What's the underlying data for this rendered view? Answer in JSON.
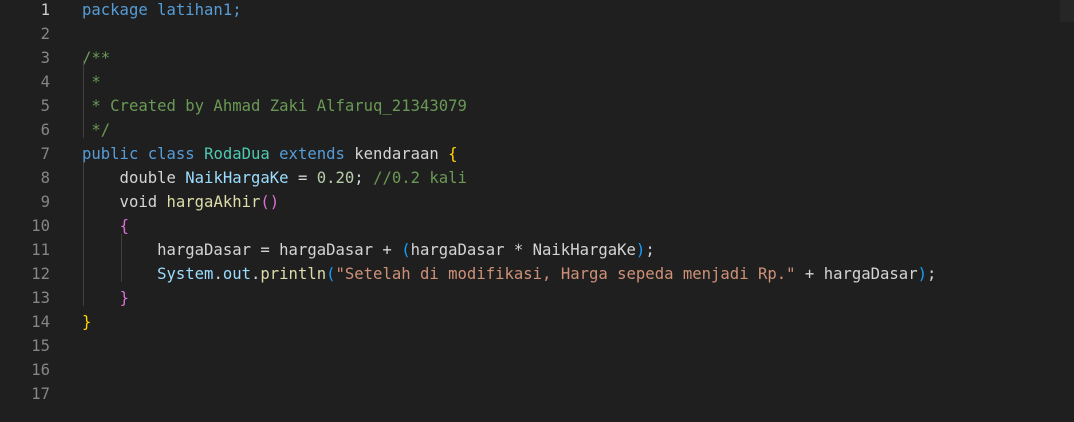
{
  "editor": {
    "language": "java",
    "active_line": 1,
    "line_numbers": [
      "1",
      "2",
      "3",
      "4",
      "5",
      "6",
      "7",
      "8",
      "9",
      "10",
      "11",
      "12",
      "13",
      "14",
      "15",
      "16",
      "17"
    ],
    "lines": [
      [
        {
          "t": "package latihan1;",
          "c": "kw"
        }
      ],
      [],
      [
        {
          "t": "/**",
          "c": "cm"
        }
      ],
      [
        {
          "t": " *",
          "c": "cm"
        }
      ],
      [
        {
          "t": " * Created by Ahmad Zaki Alfaruq_21343079",
          "c": "cm"
        }
      ],
      [
        {
          "t": " */",
          "c": "cm"
        }
      ],
      [
        {
          "t": "public class ",
          "c": "kw"
        },
        {
          "t": "RodaDua",
          "c": "cls"
        },
        {
          "t": " extends ",
          "c": "kw"
        },
        {
          "t": "kendaraan ",
          "c": "plain"
        },
        {
          "t": "{",
          "c": "br1"
        }
      ],
      [
        {
          "t": "    double ",
          "c": "plain"
        },
        {
          "t": "NaikHargaKe",
          "c": "var"
        },
        {
          "t": " = ",
          "c": "plain"
        },
        {
          "t": "0.20",
          "c": "num"
        },
        {
          "t": "; ",
          "c": "plain"
        },
        {
          "t": "//0.2 kali",
          "c": "cm"
        }
      ],
      [
        {
          "t": "    void ",
          "c": "plain"
        },
        {
          "t": "hargaAkhir",
          "c": "fn"
        },
        {
          "t": "()",
          "c": "br2"
        }
      ],
      [
        {
          "t": "    ",
          "c": "plain"
        },
        {
          "t": "{",
          "c": "br2"
        }
      ],
      [
        {
          "t": "        hargaDasar = hargaDasar + ",
          "c": "plain"
        },
        {
          "t": "(",
          "c": "br3"
        },
        {
          "t": "hargaDasar * NaikHargaKe",
          "c": "plain"
        },
        {
          "t": ")",
          "c": "br3"
        },
        {
          "t": ";",
          "c": "plain"
        }
      ],
      [
        {
          "t": "        System",
          "c": "var"
        },
        {
          "t": ".",
          "c": "plain"
        },
        {
          "t": "out",
          "c": "var"
        },
        {
          "t": ".",
          "c": "plain"
        },
        {
          "t": "println",
          "c": "fn"
        },
        {
          "t": "(",
          "c": "br3"
        },
        {
          "t": "\"Setelah di modifikasi, Harga sepeda menjadi Rp.\"",
          "c": "str"
        },
        {
          "t": " + hargaDasar",
          "c": "plain"
        },
        {
          "t": ")",
          "c": "br3"
        },
        {
          "t": ";",
          "c": "plain"
        }
      ],
      [
        {
          "t": "    ",
          "c": "plain"
        },
        {
          "t": "}",
          "c": "br2"
        }
      ],
      [
        {
          "t": "}",
          "c": "br1"
        }
      ],
      [],
      [],
      []
    ]
  }
}
